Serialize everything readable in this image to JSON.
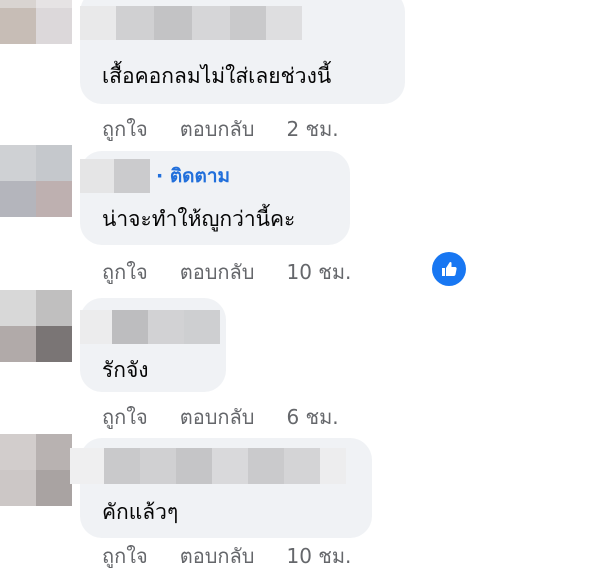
{
  "comments": [
    {
      "text": "เสื้อคอกลมไม่ใส่เลยช่วงนี้",
      "actions": {
        "like": "ถูกใจ",
        "reply": "ตอบกลับ",
        "time": "2 ชม."
      }
    },
    {
      "follow": "· ติดตาม",
      "text": "น่าจะทำให้ญูกว่านี้คะ",
      "actions": {
        "like": "ถูกใจ",
        "reply": "ตอบกลับ",
        "time": "10 ชม."
      },
      "reaction_icon": "like-thumb-icon"
    },
    {
      "text": "รักจัง",
      "actions": {
        "like": "ถูกใจ",
        "reply": "ตอบกลับ",
        "time": "6 ชม."
      }
    },
    {
      "text": "คักแล้วๆ",
      "actions": {
        "like": "ถูกใจ",
        "reply": "ตอบกลับ",
        "time": "10 ชม."
      }
    }
  ],
  "colors": {
    "bubble": "#f0f2f5",
    "secondary_text": "#65676b",
    "link": "#216fdb",
    "like_blue": "#1877f2"
  }
}
